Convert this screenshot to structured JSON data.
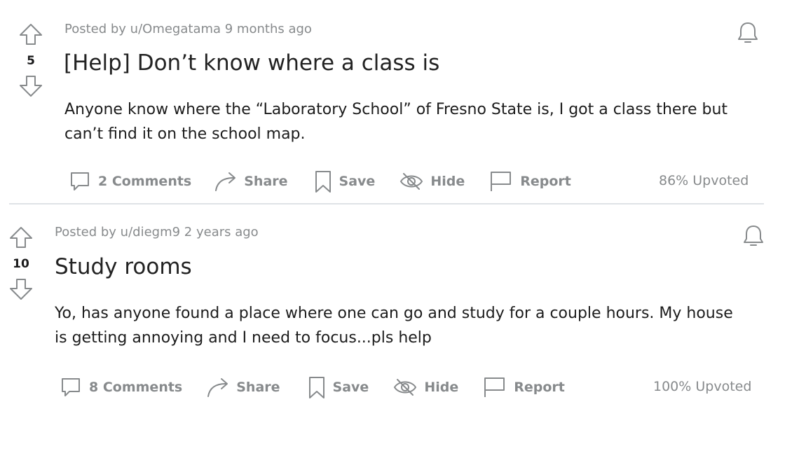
{
  "posts": [
    {
      "score": "5",
      "meta": "Posted by u/Omegatama 9 months ago",
      "title": "[Help] Don’t know where a class is",
      "body_line1": "Anyone know where the “Laboratory School” of Fresno State is, I got a class there but",
      "body_line2": "can’t find it on the school map.",
      "comments": "2 Comments",
      "share": "Share",
      "save": "Save",
      "hide": "Hide",
      "report": "Report",
      "upvoted": "86% Upvoted"
    },
    {
      "score": "10",
      "meta": "Posted by u/diegm9 2 years ago",
      "title": "Study rooms",
      "body_line1": "Yo, has anyone found a place where one can go and study for a couple hours. My house",
      "body_line2": "is getting annoying and I need to focus...pls help",
      "comments": "8 Comments",
      "share": "Share",
      "save": "Save",
      "hide": "Hide",
      "report": "Report",
      "upvoted": "100% Upvoted"
    }
  ],
  "icons": {
    "upvote": "upvote-arrow-icon",
    "downvote": "downvote-arrow-icon",
    "bell": "bell-icon",
    "comment": "comment-bubble-icon",
    "share": "share-arrow-icon",
    "save": "bookmark-icon",
    "hide": "eye-slash-icon",
    "report": "flag-icon"
  }
}
